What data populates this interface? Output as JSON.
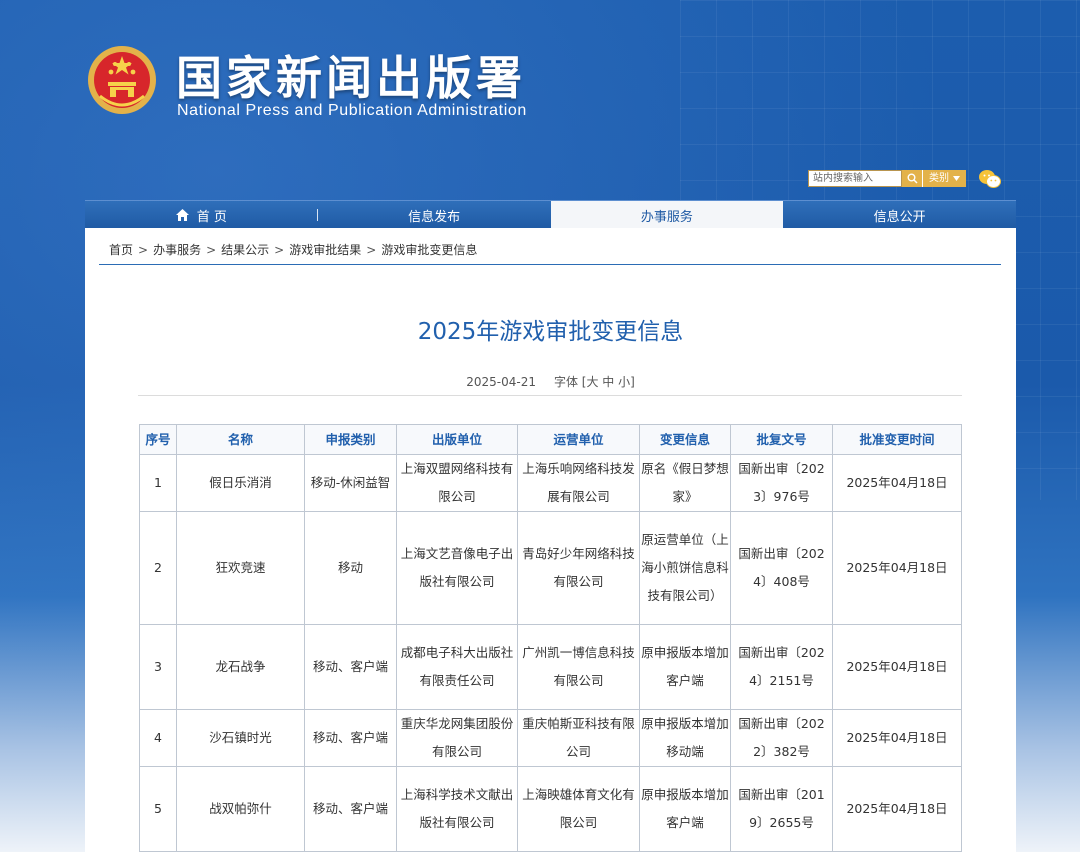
{
  "header": {
    "site_title": "国家新闻出版署",
    "site_subtitle": "National Press and Publication Administration",
    "search_placeholder": "站内搜索输入",
    "category_label": "类别"
  },
  "nav": {
    "items": [
      {
        "label": "首 页",
        "active": false
      },
      {
        "label": "信息发布",
        "active": false
      },
      {
        "label": "办事服务",
        "active": true
      },
      {
        "label": "信息公开",
        "active": false
      }
    ]
  },
  "breadcrumb": [
    "首页",
    "办事服务",
    "结果公示",
    "游戏审批结果",
    "游戏审批变更信息"
  ],
  "article": {
    "title": "2025年游戏审批变更信息",
    "date": "2025-04-21",
    "font_label": "字体 [大 中 小]"
  },
  "table": {
    "headers": [
      "序号",
      "名称",
      "申报类别",
      "出版单位",
      "运营单位",
      "变更信息",
      "批复文号",
      "批准变更时间"
    ],
    "rows": [
      [
        "1",
        "假日乐消消",
        "移动-休闲益智",
        "上海双盟网络科技有限公司",
        "上海乐响网络科技发展有限公司",
        "原名《假日梦想家》",
        "国新出审〔2023〕976号",
        "2025年04月18日"
      ],
      [
        "2",
        "狂欢竞速",
        "移动",
        "上海文艺音像电子出版社有限公司",
        "青岛好少年网络科技有限公司",
        "原运营单位（上海小煎饼信息科技有限公司）",
        "国新出审〔2024〕408号",
        "2025年04月18日"
      ],
      [
        "3",
        "龙石战争",
        "移动、客户端",
        "成都电子科大出版社有限责任公司",
        "广州凯一博信息科技有限公司",
        "原申报版本增加客户端",
        "国新出审〔2024〕2151号",
        "2025年04月18日"
      ],
      [
        "4",
        "沙石镇时光",
        "移动、客户端",
        "重庆华龙网集团股份有限公司",
        "重庆帕斯亚科技有限公司",
        "原申报版本增加移动端",
        "国新出审〔2022〕382号",
        "2025年04月18日"
      ],
      [
        "5",
        "战双帕弥什",
        "移动、客户端",
        "上海科学技术文献出版社有限公司",
        "上海映雄体育文化有限公司",
        "原申报版本增加客户端",
        "国新出审〔2019〕2655号",
        "2025年04月18日"
      ]
    ]
  },
  "colors": {
    "brand_blue": "#1f5aa4",
    "title_blue": "#2160ad",
    "search_gold": "#e3b24a"
  },
  "icons": {
    "emblem": "national-emblem",
    "search": "search-icon",
    "home": "home-icon",
    "wechat": "wechat-icon"
  }
}
